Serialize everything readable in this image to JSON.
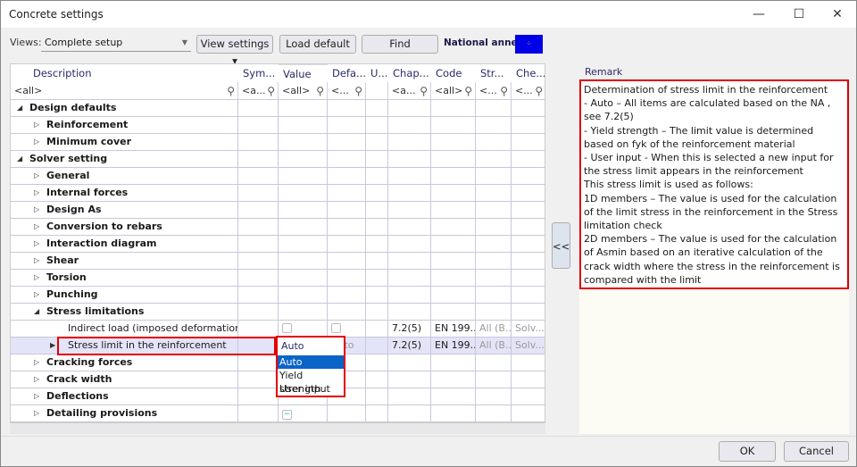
{
  "window": {
    "title": "Concrete settings",
    "minimize": "—",
    "maximize": "☐",
    "close": "✕"
  },
  "toolbar": {
    "views_label": "Views:",
    "views_value": "Complete setup",
    "view_settings": "View settings ▾",
    "load_default": "Load default",
    "find": "Find",
    "national_annex_label": "National annex:",
    "national_annex_flag": "EU"
  },
  "grid": {
    "columns": [
      "Description",
      "Sym...",
      "Value",
      "Defa...",
      "U...",
      "Chap...",
      "Code",
      "Str...",
      "Che..."
    ],
    "filters": [
      "<all>",
      "<a...",
      "<all>",
      "<...",
      "",
      "<a...",
      "<all>",
      "<...",
      "<..."
    ],
    "rows": [
      {
        "label": "Design defaults",
        "level": 0,
        "expander": "◢",
        "bold": true
      },
      {
        "label": "Reinforcement",
        "level": 1,
        "expander": "▷",
        "bold": true
      },
      {
        "label": "Minimum cover",
        "level": 1,
        "expander": "▷",
        "bold": true
      },
      {
        "label": "Solver setting",
        "level": 0,
        "expander": "◢",
        "bold": true
      },
      {
        "label": "General",
        "level": 1,
        "expander": "▷",
        "bold": true
      },
      {
        "label": "Internal forces",
        "level": 1,
        "expander": "▷",
        "bold": true
      },
      {
        "label": "Design As",
        "level": 1,
        "expander": "▷",
        "bold": true
      },
      {
        "label": "Conversion to rebars",
        "level": 1,
        "expander": "▷",
        "bold": true
      },
      {
        "label": "Interaction diagram",
        "level": 1,
        "expander": "▷",
        "bold": true
      },
      {
        "label": "Shear",
        "level": 1,
        "expander": "▷",
        "bold": true
      },
      {
        "label": "Torsion",
        "level": 1,
        "expander": "▷",
        "bold": true
      },
      {
        "label": "Punching",
        "level": 1,
        "expander": "▷",
        "bold": true
      },
      {
        "label": "Stress limitations",
        "level": 1,
        "expander": "◢",
        "bold": true
      },
      {
        "label": "Indirect load (imposed deformation)",
        "level": 2,
        "checkbox": true,
        "chapter": "7.2(5)",
        "code": "EN 199...",
        "str": "All (B...",
        "che": "Solv..."
      },
      {
        "label": "Stress limit in the reinforcement",
        "level": 2,
        "selected": true,
        "value": "Auto",
        "default": "Auto",
        "chapter": "7.2(5)",
        "code": "EN 199...",
        "str": "All (B...",
        "che": "Solv..."
      },
      {
        "label": "Cracking forces",
        "level": 1,
        "expander": "▷",
        "bold": true
      },
      {
        "label": "Crack width",
        "level": 1,
        "expander": "▷",
        "bold": true
      },
      {
        "label": "Deflections",
        "level": 1,
        "expander": "▷",
        "bold": true
      },
      {
        "label": "Detailing provisions",
        "level": 1,
        "expander": "▷",
        "bold": true,
        "minus": true
      }
    ],
    "dropdown_options": [
      "Auto",
      "Yield strength",
      "User input"
    ],
    "dropdown_selected": "Auto"
  },
  "collapse_button": "<<",
  "remark": {
    "header": "Remark",
    "text": "Determination of stress limit in the reinforcement\n- Auto – All items are calculated based on the NA , see 7.2(5)\n- Yield strength – The limit value is determined based on fyk of the reinforcement material\n- User input - When this is selected a new input for the stress limit appears in the reinforcement\nThis stress limit is used as follows:\n1D members – The value is used for the calculation of the limit stress in the reinforcement in the Stress limitation check\n2D members – The value is used for the calculation of Asmin based on an iterative calculation of the crack width where the stress in the reinforcement is compared with the limit"
  },
  "footer": {
    "ok": "OK",
    "cancel": "Cancel"
  },
  "colors": {
    "highlight": "#e00000",
    "selection": "#0a64c8",
    "selected_row": "#e4e4f8"
  }
}
